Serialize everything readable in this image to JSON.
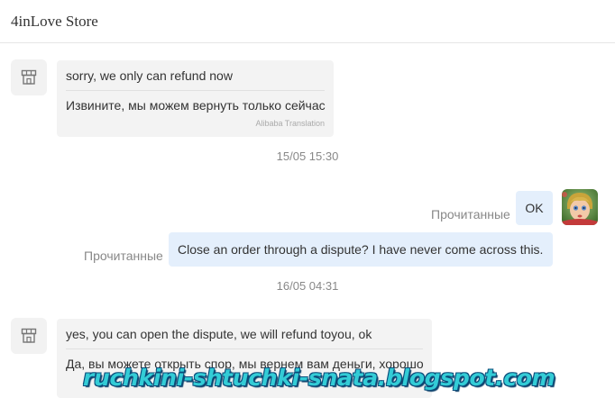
{
  "header": {
    "title": "4inLove Store"
  },
  "messages": [
    {
      "original": "sorry, we only can refund now",
      "translation": "Извините, мы можем вернуть только сейчас",
      "translation_credit": "Alibaba Translation"
    },
    {
      "original": "yes, you can open the dispute, we will refund toyou, ok",
      "translation": "Да, вы можете открыть спор, мы вернем вам деньги, хорошо"
    }
  ],
  "timestamps": [
    "15/05 15:30",
    "16/05 04:31"
  ],
  "outgoing": [
    {
      "text": "OK",
      "status": "Прочитанные"
    },
    {
      "text": "Close an order through a dispute? I have never come across this.",
      "status": "Прочитанные"
    }
  ],
  "watermark": "ruchkini-shtuchki-snata.blogspot.com",
  "icons": {
    "store_avatar": "shop-icon",
    "user_avatar": "doll-avatar"
  },
  "colors": {
    "incoming_bubble": "#f3f3f3",
    "outgoing_bubble": "#e4effc",
    "watermark": "#33ccd6"
  }
}
